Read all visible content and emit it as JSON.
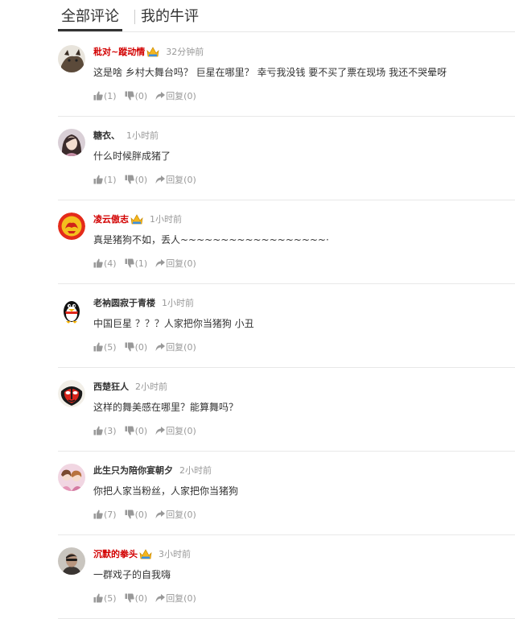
{
  "tabs": [
    {
      "label": "全部评论",
      "active": true
    },
    {
      "label": "我的牛评",
      "active": false
    }
  ],
  "comments": [
    {
      "user": "秕对~蹤动情",
      "vip": true,
      "time": "32分钟前",
      "text": "这是啥 乡村大舞台吗？ 巨星在哪里？ 幸亏我没钱 要不买了票在现场 我还不哭晕呀",
      "likes": "(1)",
      "dislikes": "(0)",
      "reply": "回复(0)",
      "avatar": "cat"
    },
    {
      "user": "糖衣、",
      "vip": false,
      "time": "1小时前",
      "text": "什么时候胖成猪了",
      "likes": "(1)",
      "dislikes": "(0)",
      "reply": "回复(0)",
      "avatar": "girl"
    },
    {
      "user": "凌云傲志",
      "vip": true,
      "time": "1小时前",
      "text": "真是猪狗不如，丢人~~~~~~~~~~~~~~~~~~·",
      "likes": "(4)",
      "dislikes": "(1)",
      "reply": "回复(0)",
      "avatar": "emblem"
    },
    {
      "user": "老衲圆寂于青楼",
      "vip": false,
      "time": "1小时前",
      "text": "中国巨星 ？？？人家把你当猪狗 小丑",
      "likes": "(5)",
      "dislikes": "(0)",
      "reply": "回复(0)",
      "avatar": "penguin"
    },
    {
      "user": "西楚狂人",
      "vip": false,
      "time": "2小时前",
      "text": "这样的舞美感在哪里？能算舞吗？",
      "likes": "(3)",
      "dislikes": "(0)",
      "reply": "回复(0)",
      "avatar": "opera-mask"
    },
    {
      "user": "此生只为陪你宴朝夕",
      "vip": false,
      "time": "2小时前",
      "text": "你把人家当粉丝，人家把你当猪狗",
      "likes": "(7)",
      "dislikes": "(0)",
      "reply": "回复(0)",
      "avatar": "girls"
    },
    {
      "user": "沉默的拳头",
      "vip": true,
      "time": "3小时前",
      "text": "一群戏子的自我嗨",
      "likes": "(5)",
      "dislikes": "(0)",
      "reply": "回复(0)",
      "avatar": "man"
    }
  ],
  "colors": {
    "vip_name": "#d20000",
    "time": "#999999",
    "text": "#333333",
    "divider": "#e8e8e8"
  },
  "icons": {
    "like": "thumb-up-icon",
    "dislike": "thumb-down-icon",
    "reply": "reply-arrow-icon",
    "vip": "vip-crown-icon"
  }
}
